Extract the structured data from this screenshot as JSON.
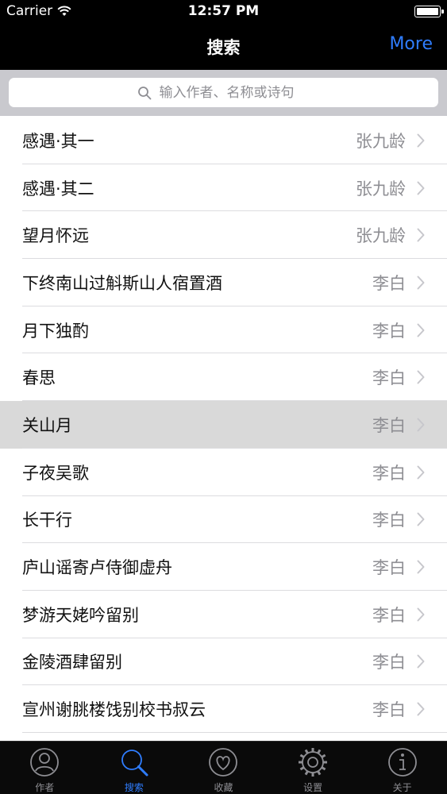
{
  "status_bar": {
    "carrier": "Carrier",
    "time": "12:57 PM"
  },
  "nav": {
    "title": "搜索",
    "more_label": "More"
  },
  "search": {
    "placeholder": "输入作者、名称或诗句"
  },
  "poems": [
    {
      "title": "感遇·其一",
      "author": "张九龄"
    },
    {
      "title": "感遇·其二",
      "author": "张九龄"
    },
    {
      "title": "望月怀远",
      "author": "张九龄"
    },
    {
      "title": "下终南山过斛斯山人宿置酒",
      "author": "李白"
    },
    {
      "title": "月下独酌",
      "author": "李白"
    },
    {
      "title": "春思",
      "author": "李白"
    },
    {
      "title": "关山月",
      "author": "李白"
    },
    {
      "title": "子夜吴歌",
      "author": "李白"
    },
    {
      "title": "长干行",
      "author": "李白"
    },
    {
      "title": "庐山谣寄卢侍御虚舟",
      "author": "李白"
    },
    {
      "title": "梦游天姥吟留别",
      "author": "李白"
    },
    {
      "title": "金陵酒肆留别",
      "author": "李白"
    },
    {
      "title": "宣州谢朓楼饯别校书叔云",
      "author": "李白"
    }
  ],
  "selected_index": 6,
  "tabs": [
    {
      "label": "作者",
      "icon": "person-icon"
    },
    {
      "label": "搜索",
      "icon": "search-icon"
    },
    {
      "label": "收藏",
      "icon": "heart-icon"
    },
    {
      "label": "设置",
      "icon": "gear-icon"
    },
    {
      "label": "关于",
      "icon": "info-icon"
    }
  ],
  "active_tab": 1,
  "colors": {
    "accent": "#2f7dff",
    "inactive": "#8e8e93",
    "selected_row": "#d9d9d9"
  }
}
